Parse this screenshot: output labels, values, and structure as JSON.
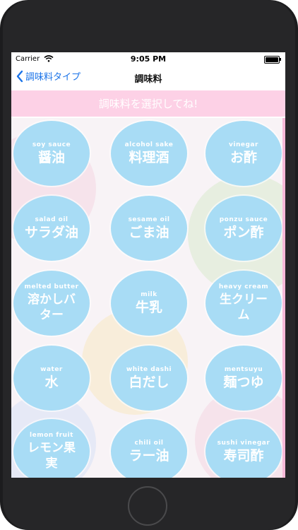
{
  "status": {
    "carrier": "Carrier",
    "time": "9:05 PM",
    "battery_level": 1.0
  },
  "nav": {
    "back_label": "調味料タイプ",
    "title": "調味料"
  },
  "banner": {
    "text": "調味料を選択してね!"
  },
  "items": [
    {
      "en": "soy sauce",
      "jp": "醤油"
    },
    {
      "en": "alcohol sake",
      "jp": "料理酒"
    },
    {
      "en": "vinegar",
      "jp": "お酢"
    },
    {
      "en": "salad oil",
      "jp": "サラダ油"
    },
    {
      "en": "sesame oil",
      "jp": "ごま油"
    },
    {
      "en": "ponzu sauce",
      "jp": "ポン酢"
    },
    {
      "en": "melted butter",
      "jp": "溶かしバター"
    },
    {
      "en": "milk",
      "jp": "牛乳"
    },
    {
      "en": "heavy cream",
      "jp": "生クリーム"
    },
    {
      "en": "water",
      "jp": "水"
    },
    {
      "en": "white dashi",
      "jp": "白だし"
    },
    {
      "en": "mentsuyu",
      "jp": "麺つゆ"
    },
    {
      "en": "lemon fruit",
      "jp": "レモン果実"
    },
    {
      "en": "chili oil",
      "jp": "ラー油"
    },
    {
      "en": "sushi vinegar",
      "jp": "寿司酢"
    }
  ],
  "colors": {
    "accent": "#1a73e8",
    "banner": "#fdd1e6",
    "bubble": "#a8dcf5"
  }
}
